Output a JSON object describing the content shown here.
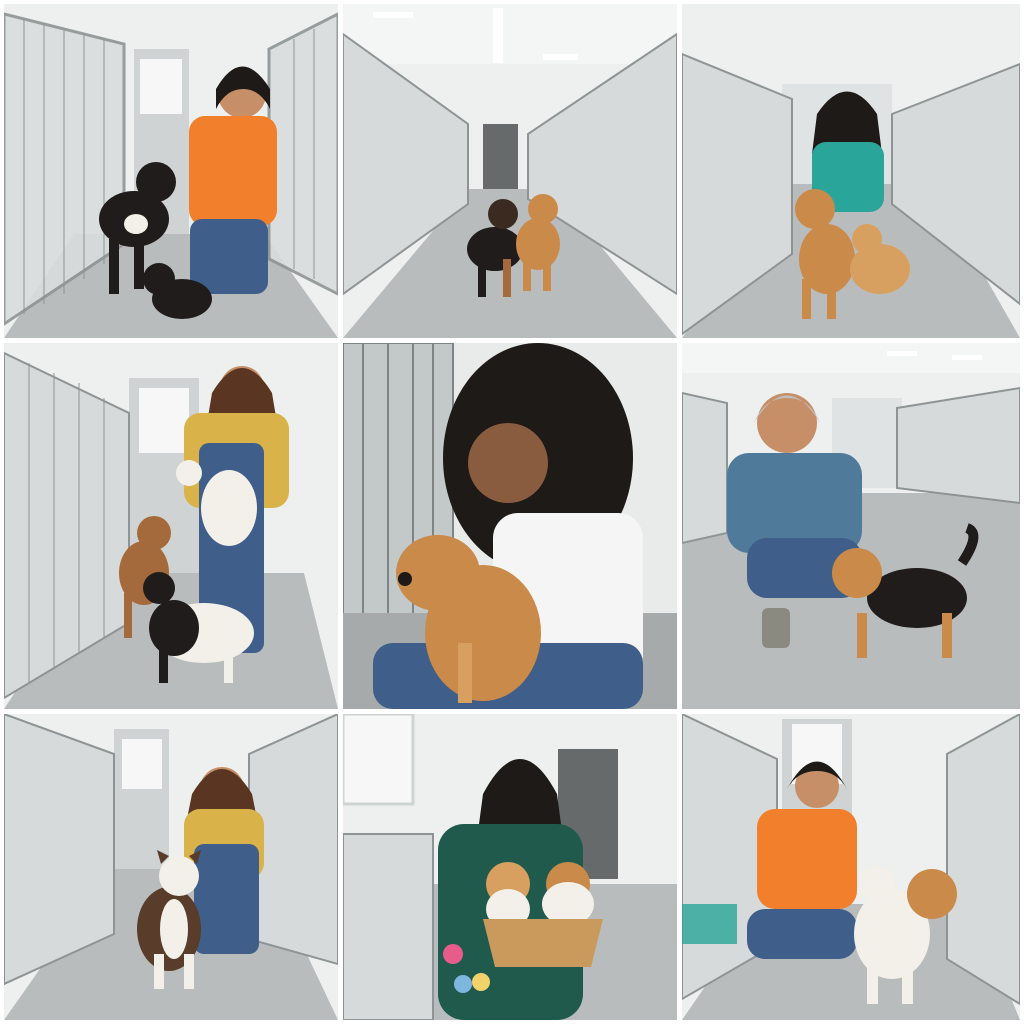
{
  "collage": {
    "layout": "3x3 photo grid",
    "background": "#ffffff",
    "panels": [
      {
        "id": "p1",
        "scene": "kennel-aisle",
        "people": "woman-orange-polo",
        "animals": [
          "dog-black",
          "puppy-black"
        ]
      },
      {
        "id": "p2",
        "scene": "kennel-aisle-long",
        "people": "none",
        "animals": [
          "dog-black-tan",
          "dog-tan"
        ]
      },
      {
        "id": "p3",
        "scene": "kennel-aisle",
        "people": "woman-teal-shirt",
        "animals": [
          "dog-tan",
          "dog-tan-small"
        ]
      },
      {
        "id": "p4",
        "scene": "kennel-aisle",
        "people": "woman-overalls",
        "animals": [
          "dog-white-held",
          "dog-brown",
          "dog-black-white"
        ]
      },
      {
        "id": "p5",
        "scene": "kennel-closeup",
        "people": "woman-white-tank",
        "animals": [
          "terrier-tan"
        ]
      },
      {
        "id": "p6",
        "scene": "kennel-room",
        "people": "woman-gray-hair-blue-polo",
        "animals": [
          "terrier-black-tan"
        ]
      },
      {
        "id": "p7",
        "scene": "kennel-aisle",
        "people": "woman-overalls",
        "animals": [
          "dog-brindle-white"
        ]
      },
      {
        "id": "p8",
        "scene": "kennel-room",
        "people": "woman-green-jacket",
        "animals": [
          "cat-orange-white",
          "cat-calico"
        ]
      },
      {
        "id": "p9",
        "scene": "kennel-aisle",
        "people": "woman-orange-polo",
        "animals": [
          "dog-white-tan"
        ]
      }
    ],
    "colors": {
      "wall": "#eef0ef",
      "floor": "#b9bcbc",
      "cage": "#8e9494",
      "door": "#cfd3d3",
      "orange": "#f27f2c",
      "teal": "#2aa59a",
      "mustard": "#d9b24a",
      "denim": "#3f5f8a",
      "white_top": "#f5f5f5",
      "blue_polo": "#4f7a9a",
      "green_jacket": "#1f5a4d",
      "skin": "#c78f67",
      "hair_black": "#1d1a18",
      "hair_brown": "#5a3522",
      "hair_gray": "#bfbfbf",
      "dog_black": "#1f1c1b",
      "dog_tan": "#c98a4a",
      "dog_white": "#f3efe9",
      "basket": "#c99a5b"
    }
  }
}
